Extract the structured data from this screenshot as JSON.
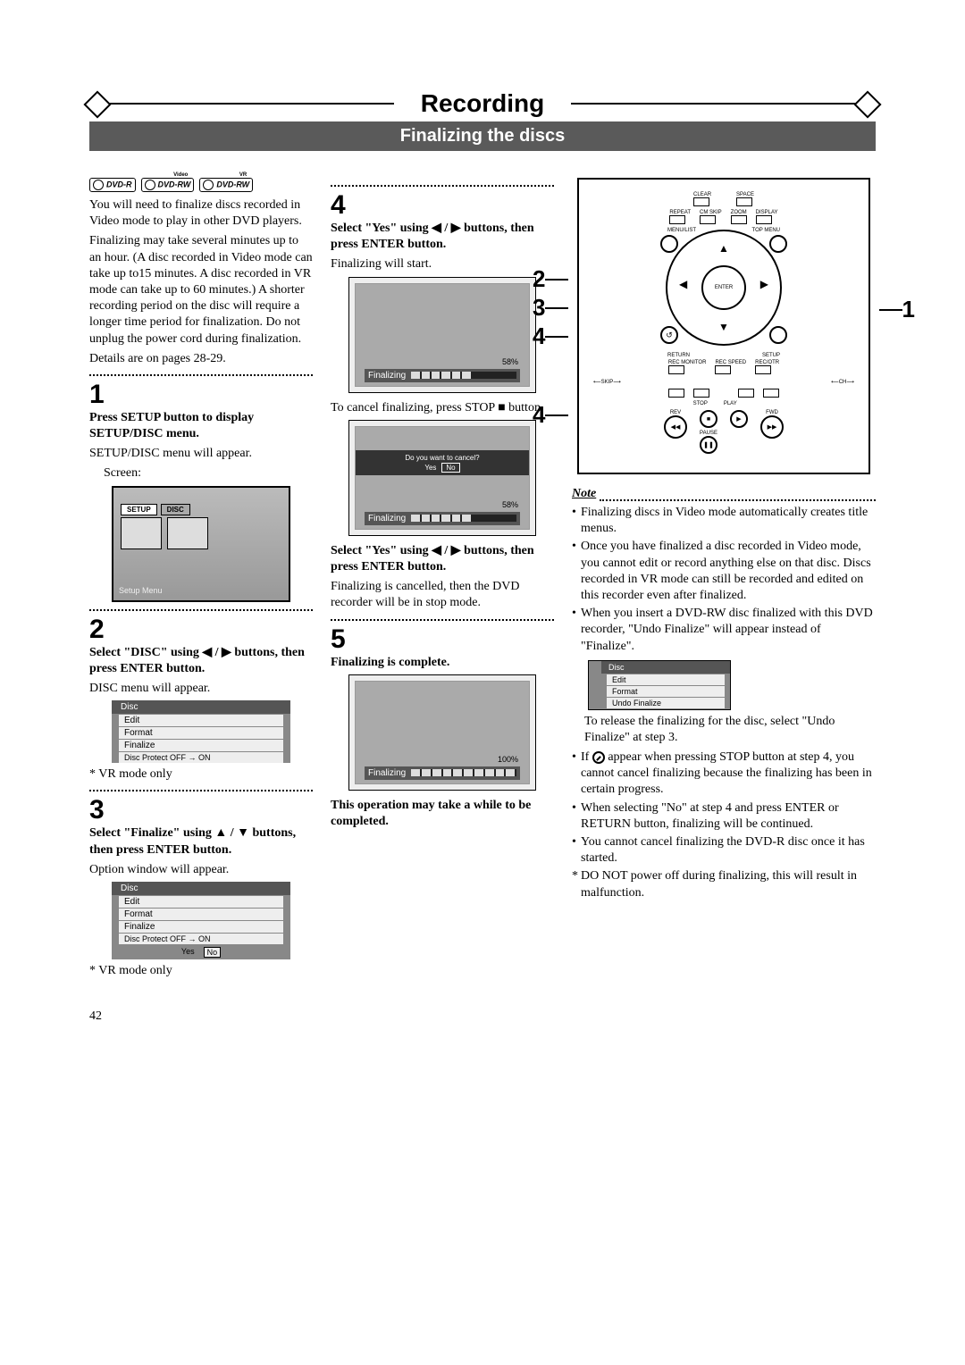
{
  "header": {
    "title": "Recording",
    "subtitle": "Finalizing the discs"
  },
  "badges": [
    "DVD-R",
    "DVD-RW",
    "DVD-RW"
  ],
  "badge_sublabels": [
    "",
    "Video",
    "VR"
  ],
  "col1": {
    "intro1": "You will need to finalize discs recorded in Video mode to play in other DVD players.",
    "intro2": "Finalizing may take several minutes up to an hour. (A disc recorded in Video mode can take up to15 minutes. A disc recorded in VR mode can take up to 60 minutes.) A shorter recording period on the disc will require a longer time period for finalization. Do not unplug the power cord during finalization.",
    "intro3": "Details are on pages 28-29.",
    "step1_num": "1",
    "step1_head": "Press SETUP button to display SETUP/DISC menu.",
    "step1_body": "SETUP/DISC menu will appear.",
    "step1_screen_label": "Screen:",
    "setup_tab1": "SETUP",
    "setup_tab2": "DISC",
    "setup_bottom": "Setup Menu",
    "step2_num": "2",
    "step2_head": "Select \"DISC\" using  ◀ / ▶ buttons, then press ENTER button.",
    "step2_body": "DISC menu will appear.",
    "disc_hdr": "Disc",
    "disc_i1": "Edit",
    "disc_i2": "Format",
    "disc_i3": "Finalize",
    "disc_i4": "Disc Protect OFF → ON",
    "vr_only": "* VR mode only",
    "step3_num": "3",
    "step3_head": "Select \"Finalize\" using ▲ / ▼ buttons, then press ENTER button.",
    "step3_body": "Option window will appear.",
    "yes": "Yes",
    "no": "No"
  },
  "col2": {
    "step4_num": "4",
    "step4_head": "Select \"Yes\" using ◀ / ▶ buttons, then press ENTER button.",
    "step4_body": "Finalizing will start.",
    "prog_label": "Finalizing",
    "prog_pct": "58%",
    "cancel_line": "To cancel finalizing, press STOP ■ button.",
    "cancel_prompt": "Do you want to cancel?",
    "cancel_yes": "Yes",
    "cancel_no": "No",
    "cancel_head": "Select \"Yes\" using ◀ / ▶ buttons, then press ENTER button.",
    "cancel_body": "Finalizing is cancelled, then the DVD recorder will be in stop mode.",
    "step5_num": "5",
    "step5_head": "Finalizing is complete.",
    "prog_pct_100": "100%",
    "complete_note": "This operation may take a while to be completed."
  },
  "remote": {
    "top_r1a": "CLEAR",
    "top_r1b": "SPACE",
    "r2a": "REPEAT",
    "r2b": "CM SKIP",
    "r2c": "ZOOM",
    "r2d": "DISPLAY",
    "r3a": "MENU/LIST",
    "r3b": "TOP MENU",
    "enter": "ENTER",
    "bl": "RETURN",
    "br": "SETUP",
    "r4a": "REC MONITOR",
    "r4b": "REC SPEED",
    "r4c": "REC/OTR",
    "skip": "SKIP",
    "ch": "CH",
    "r5a": "STOP",
    "r5b": "PLAY",
    "r6a": "REV",
    "r6b": "PAUSE",
    "r6c": "FWD",
    "callouts": {
      "c2": "2",
      "c3": "3",
      "c4a": "4",
      "c1": "1",
      "c4b": "4"
    }
  },
  "notes": {
    "head": "Note",
    "n1": "Finalizing discs in Video mode automatically creates title menus.",
    "n2": "Once you have finalized a disc recorded in Video mode, you cannot edit or record anything else on that disc. Discs recorded in VR mode can still be recorded and edited on this recorder even after finalized.",
    "n3": "When you insert a DVD-RW disc finalized with this DVD recorder, \"Undo Finalize\" will appear instead of  \"Finalize\".",
    "mini_hdr": "Disc",
    "mini_i1": "Edit",
    "mini_i2": "Format",
    "mini_i3": "Undo Finalize",
    "n3b": "To release the finalizing for the disc, select \"Undo Finalize\" at step 3.",
    "n4a": "If ",
    "n4b": " appear when pressing STOP button at step 4, you cannot cancel finalizing because the finalizing has been in certain progress.",
    "n5": "When selecting \"No\" at step 4 and press ENTER or RETURN button, finalizing will be continued.",
    "n6": "You cannot cancel finalizing the DVD-R disc once it has started.",
    "n7": "DO NOT power off during finalizing, this will result in malfunction."
  },
  "page_number": "42"
}
